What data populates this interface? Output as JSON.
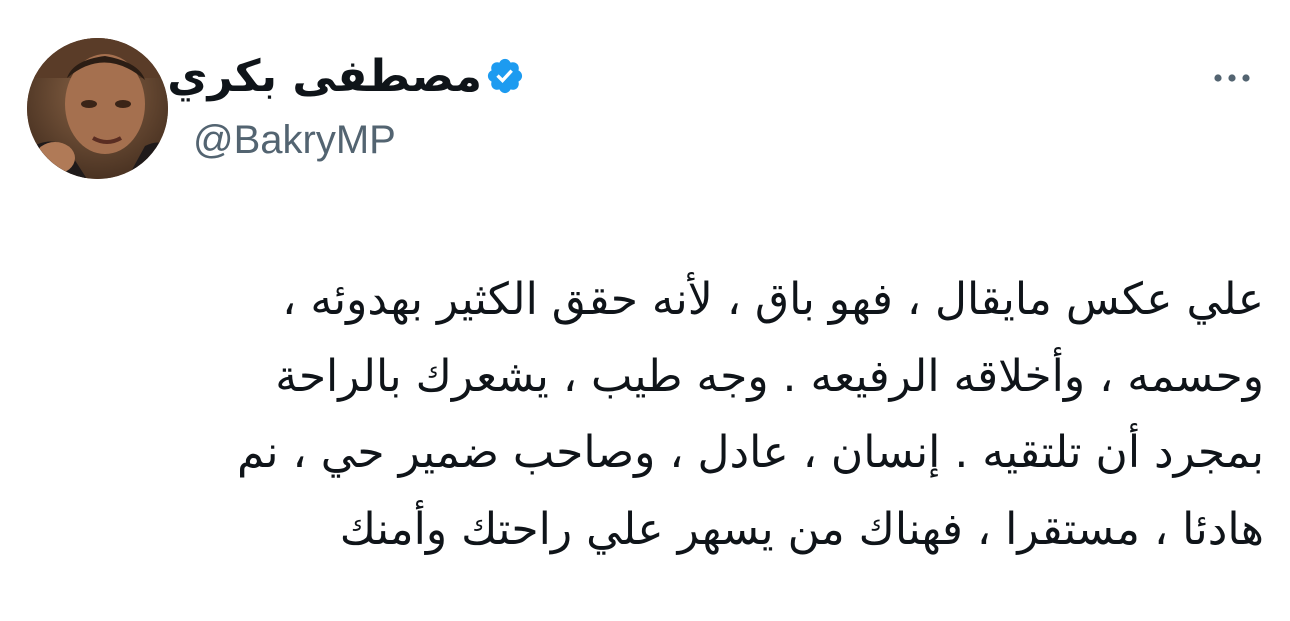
{
  "author": {
    "display_name": "مصطفى بكري",
    "handle": "@BakryMP",
    "verified": true,
    "verified_color": "#1d9bf0"
  },
  "avatar": {
    "icon": "profile-photo"
  },
  "more_button": {
    "icon": "more-horizontal-icon",
    "color": "#536471"
  },
  "tweet": {
    "lines": [
      "علي عكس مايقال ، فهو باق ، لأنه حقق الكثير بهدوئه ،",
      "وحسمه ، وأخلاقه الرفيعه . وجه طيب ، يشعرك بالراحة",
      "بمجرد أن تلتقيه . إنسان ، عادل ، وصاحب ضمير حي ، نم",
      "هادئا ، مستقرا ، فهناك من يسهر علي راحتك وأمنك"
    ]
  }
}
